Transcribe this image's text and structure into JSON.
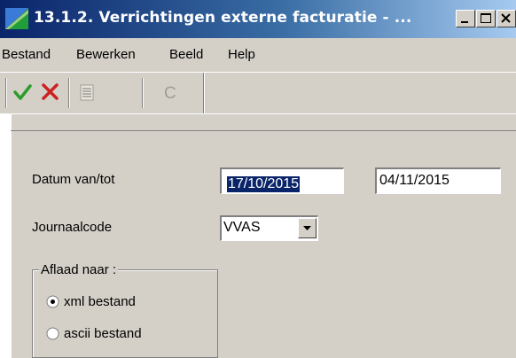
{
  "window": {
    "title": "13.1.2. Verrichtingen externe facturatie - ..."
  },
  "menu": {
    "items": [
      "Bestand",
      "Bewerken",
      "Beeld",
      "Help"
    ]
  },
  "toolbar": {
    "buttons": [
      "check-icon",
      "cross-icon",
      "list-icon",
      "refresh-c-icon"
    ],
    "refresh_glyph": "C"
  },
  "form": {
    "date_label": "Datum van/tot",
    "date_from": "17/10/2015",
    "date_to": "04/11/2015",
    "journal_label": "Journaalcode",
    "journal_value": "VVAS",
    "export_group": {
      "legend": "Aflaad naar :",
      "options": [
        "xml bestand",
        "ascii bestand"
      ],
      "selected": "xml bestand"
    }
  },
  "colors": {
    "titlebar": "#0a246a",
    "face": "#d4d0c8",
    "selection": "#0a246a",
    "check": "#2a9d2a",
    "cross": "#cc2222"
  }
}
